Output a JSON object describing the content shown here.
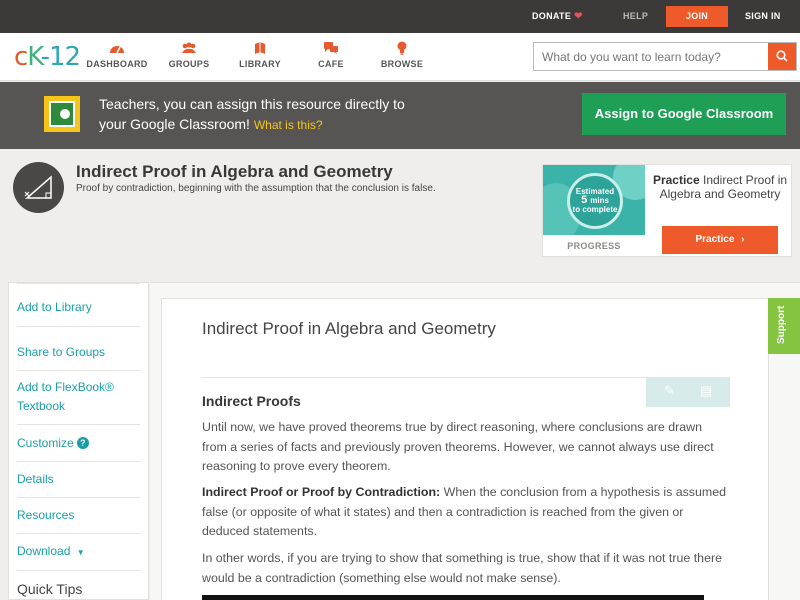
{
  "topbar": {
    "donate": "DONATE",
    "help": "HELP",
    "join": "JOIN",
    "signin": "SIGN IN"
  },
  "brand": {
    "c": "c",
    "k": "K",
    "n": "-12"
  },
  "nav": [
    {
      "label": "DASHBOARD",
      "icon": "dashboard-icon"
    },
    {
      "label": "GROUPS",
      "icon": "groups-icon"
    },
    {
      "label": "LIBRARY",
      "icon": "library-icon"
    },
    {
      "label": "CAFE",
      "icon": "cafe-icon"
    },
    {
      "label": "BROWSE",
      "icon": "browse-icon"
    }
  ],
  "search": {
    "placeholder": "What do you want to learn today?"
  },
  "classroom": {
    "line1": "Teachers, you can assign this resource directly to",
    "line2": "your Google Classroom!",
    "what": "What is this?",
    "button": "Assign to Google Classroom"
  },
  "lesson": {
    "title": "Indirect Proof in Algebra and Geometry",
    "subtitle": "Proof by contradiction, beginning with the assumption that the conclusion is false."
  },
  "practice": {
    "est_top": "Estimated",
    "est_num": "5",
    "est_unit": "mins",
    "est_bottom": "to complete",
    "progress": "PROGRESS",
    "bold": "Practice",
    "title": "Indirect Proof in Algebra and Geometry",
    "button": "Practice"
  },
  "sidebar": {
    "items": [
      "Add to Library",
      "Share to Groups",
      "Add to FlexBook® Textbook",
      "Customize",
      "Details",
      "Resources",
      "Download"
    ],
    "quick_tips": "Quick Tips"
  },
  "article": {
    "title": "Indirect Proof in Algebra and Geometry",
    "heading": "Indirect Proofs",
    "p1": "Until now, we have proved theorems true by direct reasoning, where conclusions are drawn from a series of facts and previously proven theorems. However, we cannot always use direct reasoning to prove every theorem.",
    "p2_bold": "Indirect Proof or Proof by Contradiction:",
    "p2": " When the conclusion from a hypothesis is assumed false (or opposite of what it states) and then a contradiction is reached from the given or deduced statements.",
    "p3": "In other words, if you are trying to show that something is true, show that if it was not true there would be a contradiction (something else would not make sense)."
  },
  "support": "Support"
}
